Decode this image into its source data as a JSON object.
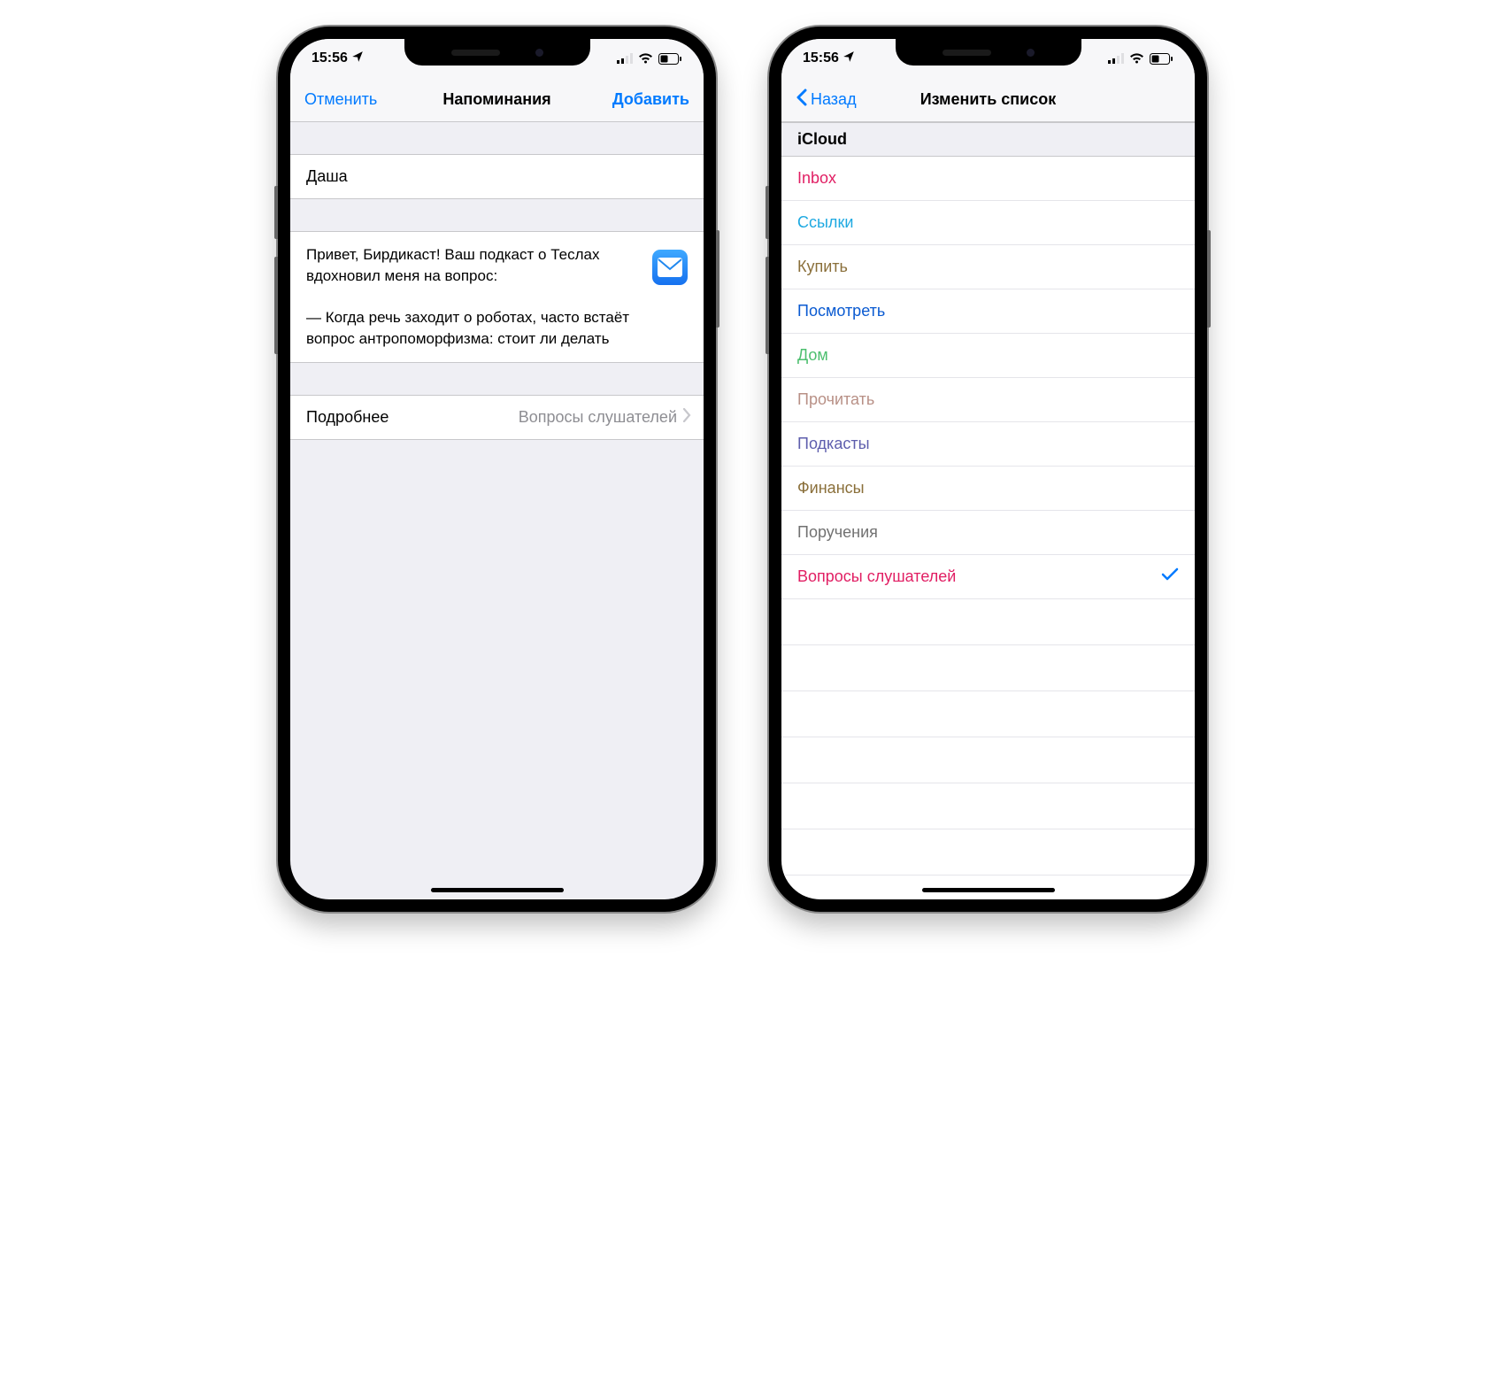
{
  "status": {
    "time": "15:56"
  },
  "left": {
    "cancel": "Отменить",
    "title": "Напоминания",
    "add": "Добавить",
    "name": "Даша",
    "note": "Привет, Бирдикаст! Ваш подкаст о Теслах вдохновил меня на вопрос:\n\n— Когда речь заходит о роботах, часто встаёт вопрос антропоморфизма: стоит ли делать",
    "details_label": "Подробнее",
    "details_value": "Вопросы слушателей"
  },
  "right": {
    "back": "Назад",
    "title": "Изменить список",
    "section": "iCloud",
    "items": [
      {
        "label": "Inbox",
        "color": "#e11e63",
        "selected": false
      },
      {
        "label": "Ссылки",
        "color": "#1ea9e1",
        "selected": false
      },
      {
        "label": "Купить",
        "color": "#8a6f3a",
        "selected": false
      },
      {
        "label": "Посмотреть",
        "color": "#0a5ad1",
        "selected": false
      },
      {
        "label": "Дом",
        "color": "#4dbf6f",
        "selected": false
      },
      {
        "label": "Прочитать",
        "color": "#b89086",
        "selected": false
      },
      {
        "label": "Подкасты",
        "color": "#5e5ead",
        "selected": false
      },
      {
        "label": "Финансы",
        "color": "#8a6f3a",
        "selected": false
      },
      {
        "label": "Поручения",
        "color": "#717171",
        "selected": false
      },
      {
        "label": "Вопросы слушателей",
        "color": "#e11e63",
        "selected": true
      }
    ]
  }
}
